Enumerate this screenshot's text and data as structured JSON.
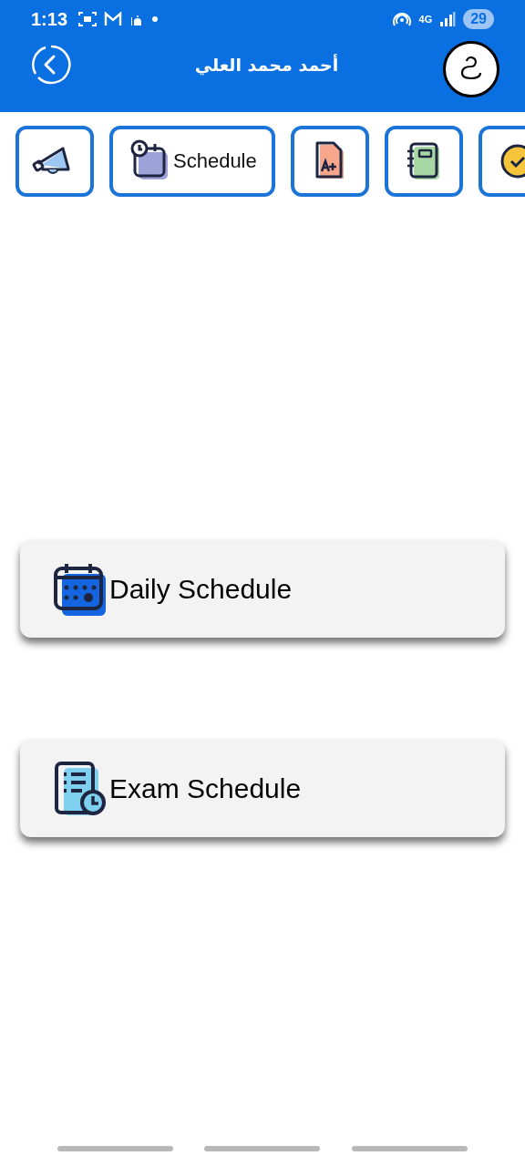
{
  "status_bar": {
    "time": "1:13",
    "network": "4G",
    "battery": "29"
  },
  "header": {
    "title": "أحمد محمد العلي"
  },
  "tabs": [
    {
      "kind": "megaphone",
      "selected": false
    },
    {
      "kind": "calendar",
      "label": "Schedule",
      "selected": true
    },
    {
      "kind": "grade",
      "selected": false
    },
    {
      "kind": "notebook",
      "selected": false
    },
    {
      "kind": "badge",
      "selected": false
    }
  ],
  "cards": [
    {
      "kind": "calendar",
      "label": "Daily Schedule"
    },
    {
      "kind": "exam",
      "label": "Exam Schedule"
    }
  ]
}
